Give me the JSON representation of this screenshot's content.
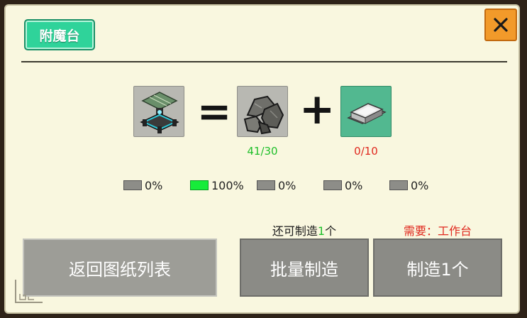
{
  "title": "附魔台",
  "close_icon": "close-x-icon",
  "recipe": {
    "result": {
      "icon": "enchanting-table-icon"
    },
    "equals": "=",
    "plus": "+",
    "ingredients": [
      {
        "icon": "stone-ore-icon",
        "count": "41/30",
        "color": "#1fbf2a"
      },
      {
        "icon": "silver-ingot-icon",
        "count": "0/10",
        "color": "#e0281e"
      }
    ]
  },
  "probabilities": [
    "0%",
    "100%",
    "0%",
    "0%",
    "0%"
  ],
  "active_probability_index": 1,
  "remaining": {
    "prefix": "还可制造",
    "count": "1",
    "suffix": "个"
  },
  "requirement": "需要：工作台",
  "buttons": {
    "back": "返回图纸列表",
    "batch": "批量制造",
    "craft_one": "制造1个"
  },
  "colors": {
    "panel": "#f9f7df",
    "title_badge": "#2fd39a",
    "close_button": "#f29a2a",
    "ok": "#1fbf2a",
    "warn": "#e0281e"
  }
}
